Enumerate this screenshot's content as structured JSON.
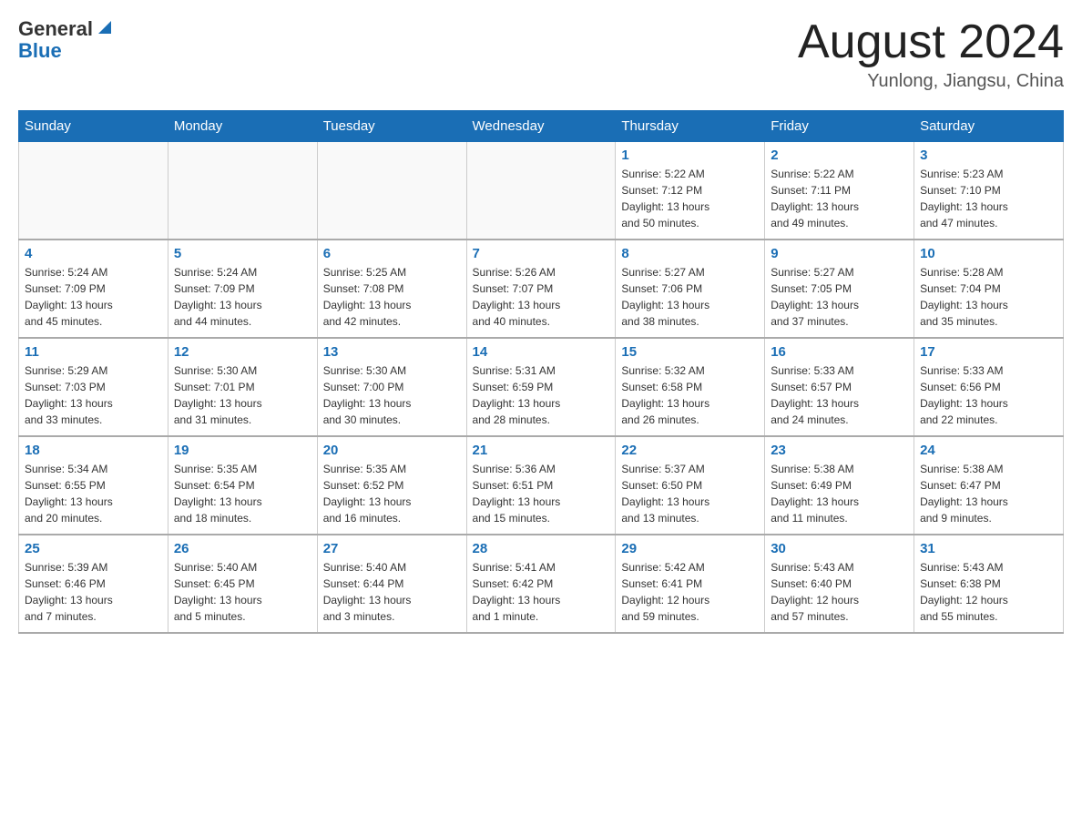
{
  "header": {
    "logo_general": "General",
    "logo_blue": "Blue",
    "month_title": "August 2024",
    "location": "Yunlong, Jiangsu, China"
  },
  "days_of_week": [
    "Sunday",
    "Monday",
    "Tuesday",
    "Wednesday",
    "Thursday",
    "Friday",
    "Saturday"
  ],
  "weeks": [
    [
      {
        "day": "",
        "info": ""
      },
      {
        "day": "",
        "info": ""
      },
      {
        "day": "",
        "info": ""
      },
      {
        "day": "",
        "info": ""
      },
      {
        "day": "1",
        "info": "Sunrise: 5:22 AM\nSunset: 7:12 PM\nDaylight: 13 hours\nand 50 minutes."
      },
      {
        "day": "2",
        "info": "Sunrise: 5:22 AM\nSunset: 7:11 PM\nDaylight: 13 hours\nand 49 minutes."
      },
      {
        "day": "3",
        "info": "Sunrise: 5:23 AM\nSunset: 7:10 PM\nDaylight: 13 hours\nand 47 minutes."
      }
    ],
    [
      {
        "day": "4",
        "info": "Sunrise: 5:24 AM\nSunset: 7:09 PM\nDaylight: 13 hours\nand 45 minutes."
      },
      {
        "day": "5",
        "info": "Sunrise: 5:24 AM\nSunset: 7:09 PM\nDaylight: 13 hours\nand 44 minutes."
      },
      {
        "day": "6",
        "info": "Sunrise: 5:25 AM\nSunset: 7:08 PM\nDaylight: 13 hours\nand 42 minutes."
      },
      {
        "day": "7",
        "info": "Sunrise: 5:26 AM\nSunset: 7:07 PM\nDaylight: 13 hours\nand 40 minutes."
      },
      {
        "day": "8",
        "info": "Sunrise: 5:27 AM\nSunset: 7:06 PM\nDaylight: 13 hours\nand 38 minutes."
      },
      {
        "day": "9",
        "info": "Sunrise: 5:27 AM\nSunset: 7:05 PM\nDaylight: 13 hours\nand 37 minutes."
      },
      {
        "day": "10",
        "info": "Sunrise: 5:28 AM\nSunset: 7:04 PM\nDaylight: 13 hours\nand 35 minutes."
      }
    ],
    [
      {
        "day": "11",
        "info": "Sunrise: 5:29 AM\nSunset: 7:03 PM\nDaylight: 13 hours\nand 33 minutes."
      },
      {
        "day": "12",
        "info": "Sunrise: 5:30 AM\nSunset: 7:01 PM\nDaylight: 13 hours\nand 31 minutes."
      },
      {
        "day": "13",
        "info": "Sunrise: 5:30 AM\nSunset: 7:00 PM\nDaylight: 13 hours\nand 30 minutes."
      },
      {
        "day": "14",
        "info": "Sunrise: 5:31 AM\nSunset: 6:59 PM\nDaylight: 13 hours\nand 28 minutes."
      },
      {
        "day": "15",
        "info": "Sunrise: 5:32 AM\nSunset: 6:58 PM\nDaylight: 13 hours\nand 26 minutes."
      },
      {
        "day": "16",
        "info": "Sunrise: 5:33 AM\nSunset: 6:57 PM\nDaylight: 13 hours\nand 24 minutes."
      },
      {
        "day": "17",
        "info": "Sunrise: 5:33 AM\nSunset: 6:56 PM\nDaylight: 13 hours\nand 22 minutes."
      }
    ],
    [
      {
        "day": "18",
        "info": "Sunrise: 5:34 AM\nSunset: 6:55 PM\nDaylight: 13 hours\nand 20 minutes."
      },
      {
        "day": "19",
        "info": "Sunrise: 5:35 AM\nSunset: 6:54 PM\nDaylight: 13 hours\nand 18 minutes."
      },
      {
        "day": "20",
        "info": "Sunrise: 5:35 AM\nSunset: 6:52 PM\nDaylight: 13 hours\nand 16 minutes."
      },
      {
        "day": "21",
        "info": "Sunrise: 5:36 AM\nSunset: 6:51 PM\nDaylight: 13 hours\nand 15 minutes."
      },
      {
        "day": "22",
        "info": "Sunrise: 5:37 AM\nSunset: 6:50 PM\nDaylight: 13 hours\nand 13 minutes."
      },
      {
        "day": "23",
        "info": "Sunrise: 5:38 AM\nSunset: 6:49 PM\nDaylight: 13 hours\nand 11 minutes."
      },
      {
        "day": "24",
        "info": "Sunrise: 5:38 AM\nSunset: 6:47 PM\nDaylight: 13 hours\nand 9 minutes."
      }
    ],
    [
      {
        "day": "25",
        "info": "Sunrise: 5:39 AM\nSunset: 6:46 PM\nDaylight: 13 hours\nand 7 minutes."
      },
      {
        "day": "26",
        "info": "Sunrise: 5:40 AM\nSunset: 6:45 PM\nDaylight: 13 hours\nand 5 minutes."
      },
      {
        "day": "27",
        "info": "Sunrise: 5:40 AM\nSunset: 6:44 PM\nDaylight: 13 hours\nand 3 minutes."
      },
      {
        "day": "28",
        "info": "Sunrise: 5:41 AM\nSunset: 6:42 PM\nDaylight: 13 hours\nand 1 minute."
      },
      {
        "day": "29",
        "info": "Sunrise: 5:42 AM\nSunset: 6:41 PM\nDaylight: 12 hours\nand 59 minutes."
      },
      {
        "day": "30",
        "info": "Sunrise: 5:43 AM\nSunset: 6:40 PM\nDaylight: 12 hours\nand 57 minutes."
      },
      {
        "day": "31",
        "info": "Sunrise: 5:43 AM\nSunset: 6:38 PM\nDaylight: 12 hours\nand 55 minutes."
      }
    ]
  ]
}
